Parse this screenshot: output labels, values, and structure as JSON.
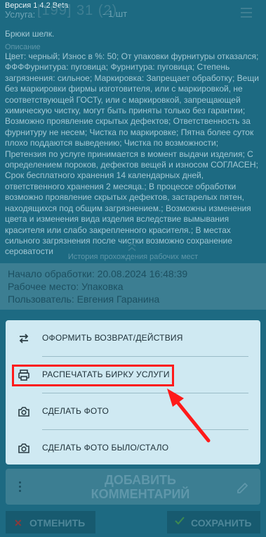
{
  "header": {
    "version": "Версия 1.4.2 Beta",
    "service_label": "Услуга:",
    "service_code": "[199] 31 (2)",
    "service_qty": "- 1 шт"
  },
  "item": {
    "name": "Брюки шелк.",
    "description_label": "Описание",
    "description_text": "Цвет: черный; Износ в %: 50; От упаковки фурнитуры отказался; ФФФФурнитура: пуговица; Фурнитура: пуговица; Степень загрязнения: сильное; Маркировка: Запрещает обработку; Вещи без маркировки фирмы изготовителя, или с маркировкой, не соответствующей ГОСТу, или с маркировкой, запрещающей химическую чистку, могут быть приняты только без гарантии; Возможно проявление скрытых дефектов; Ответственность за фурнитуру не несем; Чистка по маркировке; Пятна более суток плохо поддаются выведению; Чистка по возможности; Претензия по услуге принимается в момент выдачи изделия; С определением пороков, дефектов вещей и износом СОГЛАСЕН; Срок бесплатного хранения 14 календарных дней, ответственного хранения 2 месяца.; В процессе обработки возможно проявление скрытых дефектов, застарелых пятен, находящихся под общим загрязнением.; Возможны изменения цвета и изменения вида изделия вследствие вымывания красителя или слабо закрепленного красителя.; В местах сильного загрязнения после чистки возможно сохранение сероватости"
  },
  "history": {
    "title": "История прохождения рабочих мест",
    "start": "Начало обработки: 20.08.2024 16:48:39",
    "workplace": "Рабочее место: Упаковка",
    "user": "Пользователь: Евгения Гаранина"
  },
  "sheet": {
    "items": [
      {
        "label": "ОФОРМИТЬ ВОЗВРАТ/ДЕЙСТВИЯ",
        "icon": "swap-icon"
      },
      {
        "label": "РАСПЕЧАТАТЬ БИРКУ УСЛУГИ",
        "icon": "printer-icon"
      },
      {
        "label": "СДЕЛАТЬ ФОТО",
        "icon": "camera-icon"
      },
      {
        "label": "СДЕЛАТЬ ФОТО БЫЛО/СТАЛО",
        "icon": "camera-icon"
      }
    ]
  },
  "actions": {
    "comment_label_1": "ДОБАВИТЬ",
    "comment_label_2": "КОММЕНТАРИЙ",
    "cancel_label": "ОТМЕНИТЬ",
    "save_label": "СОХРАНИТЬ"
  },
  "colors": {
    "highlight": "#ff1a1a",
    "sheet_bg": "#cfe9f2",
    "overlay_bg": "#1d6a82"
  }
}
